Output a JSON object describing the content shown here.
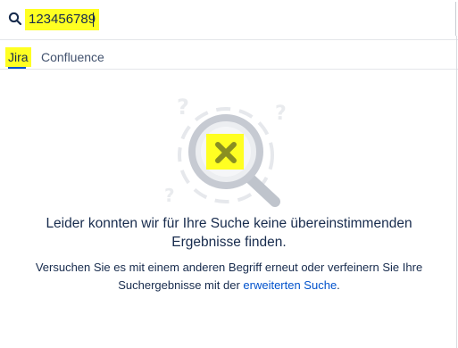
{
  "search": {
    "value": "123456789"
  },
  "tabs": [
    {
      "label": "Jira",
      "active": true
    },
    {
      "label": "Confluence",
      "active": false
    }
  ],
  "empty_state": {
    "headline_line1": "Leider konnten wir für Ihre Suche keine übereinstimmenden",
    "headline_line2": "Ergebnisse finden.",
    "sub_line1": "Versuchen Sie es mit einem anderen Begriff erneut oder verfeinern Sie Ihre",
    "sub_line2_prefix": "Suchergebnisse mit der ",
    "sub_link": "erweiterten Suche",
    "sub_line2_suffix": "."
  },
  "colors": {
    "highlight": "#ffff22",
    "link": "#0052cc",
    "text": "#172b4d"
  },
  "icons": [
    "search-icon",
    "magnifier-no-results-icon",
    "question-mark-icon",
    "cross-icon"
  ]
}
